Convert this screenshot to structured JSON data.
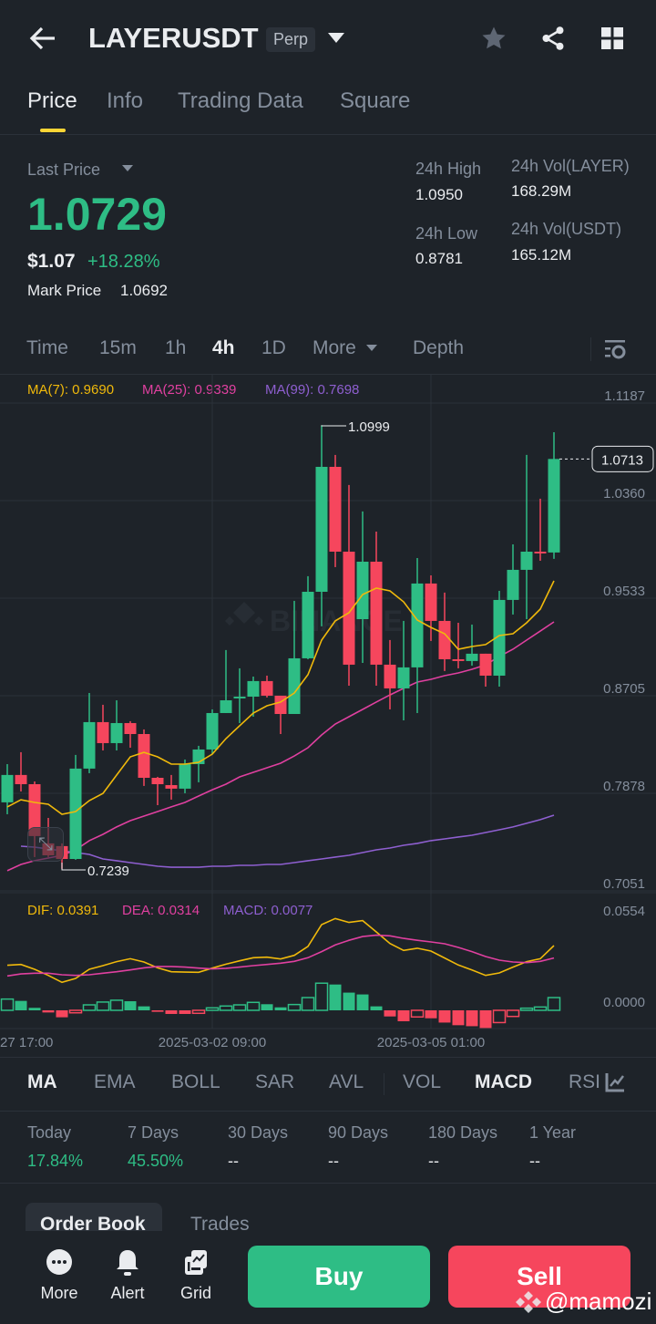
{
  "header": {
    "title": "LAYERUSDT",
    "badge": "Perp"
  },
  "tabs": [
    "Price",
    "Info",
    "Trading Data",
    "Square"
  ],
  "price": {
    "last_price_label": "Last Price",
    "last_price": "1.0729",
    "usd": "$1.07",
    "change": "+18.28%",
    "mark_label": "Mark Price",
    "mark_value": "1.0692"
  },
  "stats": {
    "high_label": "24h High",
    "high": "1.0950",
    "low_label": "24h Low",
    "low": "0.8781",
    "vol_layer_label": "24h Vol(LAYER)",
    "vol_layer": "168.29M",
    "vol_usdt_label": "24h Vol(USDT)",
    "vol_usdt": "165.12M"
  },
  "intervals": [
    "Time",
    "15m",
    "1h",
    "4h",
    "1D",
    "More",
    "Depth"
  ],
  "ma_legend": {
    "ma7": "MA(7): 0.9690",
    "ma25": "MA(25): 0.9339",
    "ma99": "MA(99): 0.7698"
  },
  "macd_legend": {
    "dif": "DIF: 0.0391",
    "dea": "DEA: 0.0314",
    "macd": "MACD: 0.0077"
  },
  "colors": {
    "up": "#2ebd85",
    "down": "#f6465d",
    "ma7": "#f0b90b",
    "ma25": "#e040a0",
    "ma99": "#8e5fd0",
    "accent": "#fcd535"
  },
  "indicators": [
    "MA",
    "EMA",
    "BOLL",
    "SAR",
    "AVL",
    "VOL",
    "MACD",
    "RSI"
  ],
  "returns": [
    {
      "label": "Today",
      "value": "17.84%"
    },
    {
      "label": "7 Days",
      "value": "45.50%"
    },
    {
      "label": "30 Days",
      "value": "--"
    },
    {
      "label": "90 Days",
      "value": "--"
    },
    {
      "label": "180 Days",
      "value": "--"
    },
    {
      "label": "1 Year",
      "value": "--"
    }
  ],
  "book_tabs": [
    "Order Book",
    "Trades"
  ],
  "bottom": {
    "more": "More",
    "alert": "Alert",
    "grid": "Grid",
    "buy": "Buy",
    "sell": "Sell",
    "watermark": "@mamozi"
  },
  "chart_data": {
    "type": "candlestick",
    "price_ticks": [
      "1.1187",
      "1.0360",
      "0.9533",
      "0.8705",
      "0.7878",
      "0.7051"
    ],
    "price_axis": [
      0.7051,
      1.1187
    ],
    "macd_ticks": [
      "0.0554",
      "0.0000"
    ],
    "time_ticks": [
      "27 17:00",
      "2025-03-02 09:00",
      "2025-03-05 01:00"
    ],
    "high_marker": "1.0999",
    "low_marker": "0.7239",
    "last_marker": "1.0713",
    "ohlc": [
      [
        0.7802,
        0.8126,
        0.7701,
        0.8034
      ],
      [
        0.8034,
        0.8227,
        0.7894,
        0.7956
      ],
      [
        0.7956,
        0.7979,
        0.7338,
        0.7516
      ],
      [
        0.7454,
        0.767,
        0.7338,
        0.7353
      ],
      [
        0.7431,
        0.7454,
        0.7239,
        0.7322
      ],
      [
        0.7322,
        0.8204,
        0.7315,
        0.8088
      ],
      [
        0.8088,
        0.8729,
        0.8049,
        0.8482
      ],
      [
        0.8482,
        0.8629,
        0.8242,
        0.8304
      ],
      [
        0.8304,
        0.8667,
        0.8242,
        0.8474
      ],
      [
        0.8474,
        0.849,
        0.8265,
        0.8381
      ],
      [
        0.8381,
        0.842,
        0.7941,
        0.801
      ],
      [
        0.801,
        0.8018,
        0.7778,
        0.7956
      ],
      [
        0.7948,
        0.8034,
        0.7825,
        0.7918
      ],
      [
        0.7918,
        0.8165,
        0.7879,
        0.8126
      ],
      [
        0.8126,
        0.8281,
        0.7972,
        0.825
      ],
      [
        0.825,
        0.859,
        0.8211,
        0.8559
      ],
      [
        0.8559,
        0.9093,
        0.8559,
        0.8667
      ],
      [
        0.8683,
        0.8938,
        0.8474,
        0.8698
      ],
      [
        0.8698,
        0.8868,
        0.8528,
        0.883
      ],
      [
        0.883,
        0.8876,
        0.8691,
        0.8706
      ],
      [
        0.8706,
        0.8706,
        0.8381,
        0.8551
      ],
      [
        0.8551,
        0.951,
        0.8551,
        0.9023
      ],
      [
        0.9023,
        0.9719,
        0.9015,
        0.9587
      ],
      [
        0.9587,
        1.0999,
        0.9294,
        1.0646
      ],
      [
        1.0646,
        1.0747,
        0.9796,
        0.9927
      ],
      [
        0.9927,
        1.0492,
        0.8791,
        0.8969
      ],
      [
        0.9355,
        1.0268,
        0.8984,
        0.9842
      ],
      [
        0.9842,
        1.0097,
        0.8791,
        0.8969
      ],
      [
        0.8969,
        0.9178,
        0.859,
        0.8768
      ],
      [
        0.8768,
        0.934,
        0.8497,
        0.8946
      ],
      [
        0.8946,
        0.9873,
        0.8559,
        0.9657
      ],
      [
        0.9657,
        0.9726,
        0.917,
        0.934
      ],
      [
        0.934,
        0.958,
        0.8915,
        0.9015
      ],
      [
        0.9015,
        0.9324,
        0.8938,
        0.9
      ],
      [
        0.9,
        0.9309,
        0.8961,
        0.9062
      ],
      [
        0.9062,
        0.9062,
        0.8783,
        0.8876
      ],
      [
        0.8876,
        0.9595,
        0.8783,
        0.9518
      ],
      [
        0.9518,
        0.9989,
        0.9394,
        0.9773
      ],
      [
        0.9773,
        1.0747,
        0.9355,
        0.9927
      ],
      [
        0.9927,
        1.0376,
        0.985,
        0.9912
      ],
      [
        0.992,
        1.094,
        0.9866,
        1.0713
      ]
    ],
    "ma7": [
      0.7763,
      0.7824,
      0.7801,
      0.7786,
      0.7701,
      0.7724,
      0.7817,
      0.7878,
      0.8033,
      0.8188,
      0.8226,
      0.8188,
      0.8126,
      0.8126,
      0.8141,
      0.8211,
      0.8342,
      0.8451,
      0.8559,
      0.8621,
      0.8652,
      0.8729,
      0.8884,
      0.9177,
      0.934,
      0.9409,
      0.9564,
      0.9618,
      0.9595,
      0.9502,
      0.9347,
      0.9285,
      0.9231,
      0.91,
      0.9123,
      0.9139,
      0.9216,
      0.9231,
      0.9324,
      0.944,
      0.968
    ],
    "ma25": [
      0.7222,
      0.7276,
      0.7307,
      0.733,
      0.7353,
      0.7399,
      0.7477,
      0.7531,
      0.7593,
      0.7647,
      0.7685,
      0.7724,
      0.7763,
      0.7801,
      0.7855,
      0.7909,
      0.7956,
      0.8018,
      0.8056,
      0.8095,
      0.8134,
      0.8195,
      0.8265,
      0.8373,
      0.8466,
      0.8528,
      0.859,
      0.8652,
      0.8713,
      0.8768,
      0.8822,
      0.8845,
      0.8876,
      0.8899,
      0.893,
      0.8968,
      0.9038,
      0.91,
      0.9177,
      0.9254,
      0.9332
    ],
    "ma99": [
      null,
      0.743,
      0.7422,
      0.7407,
      0.7391,
      0.7376,
      0.7361,
      0.7322,
      0.7307,
      0.7291,
      0.7276,
      0.726,
      0.7252,
      0.7252,
      0.7252,
      0.726,
      0.726,
      0.7268,
      0.7268,
      0.7276,
      0.7276,
      0.7291,
      0.7307,
      0.7322,
      0.7338,
      0.7353,
      0.7376,
      0.7399,
      0.7415,
      0.7438,
      0.7454,
      0.7477,
      0.7492,
      0.7508,
      0.7523,
      0.7546,
      0.7569,
      0.7593,
      0.7624,
      0.7655,
      0.7693
    ],
    "macd_hist": [
      0.0068,
      0.0057,
      0.0015,
      -0.0013,
      -0.0042,
      -0.0015,
      0.0033,
      0.005,
      0.0061,
      0.0055,
      0.0024,
      -0.0009,
      -0.0022,
      -0.0022,
      -0.0018,
      0.0015,
      0.0026,
      0.0033,
      0.0048,
      0.0037,
      0.0018,
      0.0035,
      0.0077,
      0.0164,
      0.0156,
      0.0107,
      0.0096,
      0.0024,
      -0.0037,
      -0.0066,
      -0.004,
      -0.0048,
      -0.0074,
      -0.009,
      -0.0096,
      -0.0107,
      -0.0074,
      -0.0037,
      0.0013,
      0.002,
      0.0077
    ],
    "dif": [
      0.0272,
      0.0277,
      0.0248,
      0.0211,
      0.0169,
      0.0193,
      0.0248,
      0.027,
      0.0294,
      0.0312,
      0.0292,
      0.0257,
      0.0233,
      0.0231,
      0.023,
      0.0255,
      0.0279,
      0.0299,
      0.0318,
      0.0321,
      0.031,
      0.0332,
      0.0386,
      0.0518,
      0.0555,
      0.0531,
      0.0542,
      0.0474,
      0.0404,
      0.0362,
      0.0375,
      0.0358,
      0.0316,
      0.0274,
      0.0244,
      0.0211,
      0.0226,
      0.0261,
      0.0294,
      0.0312,
      0.0391
    ],
    "dea": [
      0.0208,
      0.022,
      0.0224,
      0.0224,
      0.0215,
      0.0211,
      0.0215,
      0.0224,
      0.0233,
      0.0244,
      0.0257,
      0.0265,
      0.0265,
      0.0261,
      0.0255,
      0.025,
      0.0254,
      0.0261,
      0.027,
      0.0277,
      0.0285,
      0.0296,
      0.0318,
      0.0355,
      0.0395,
      0.0423,
      0.0446,
      0.0454,
      0.045,
      0.0435,
      0.0423,
      0.0413,
      0.0402,
      0.038,
      0.0355,
      0.0325,
      0.0303,
      0.0292,
      0.0288,
      0.0296,
      0.0316
    ]
  }
}
